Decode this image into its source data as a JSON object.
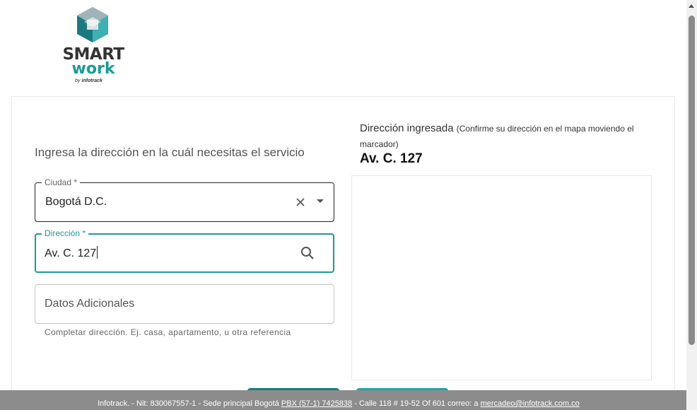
{
  "logo": {
    "line1": "SMART",
    "line2": "work",
    "by": "by",
    "brand": "infotrack"
  },
  "form": {
    "heading": "Ingresa la dirección en la cuál necesitas el servicio",
    "ciudad": {
      "label": "Ciudad *",
      "value": "Bogotá D.C."
    },
    "direccion": {
      "label": "Dirección *",
      "value": "Av. C. 127"
    },
    "datos": {
      "placeholder": "Datos Adicionales",
      "helper": "Completar dirección. Ej. casa, apartamento, u otra referencia"
    }
  },
  "address_panel": {
    "title": "Dirección ingresada",
    "hint": "(Confirme su dirección en el mapa moviendo el marcador)",
    "value": "Av. C. 127"
  },
  "footer": {
    "text1": "Infotrack. - Nit: 830067557-1 - Sede principal Bogotá ",
    "phone": "PBX (57-1) 7425838",
    "text2": " - Calle 118 # 19-52 Of 601   correo: a ",
    "email": "mercadeo@infotrack.com.co"
  },
  "colors": {
    "accent": "#1a9a9a",
    "footer_bg": "#8c8c8c"
  }
}
